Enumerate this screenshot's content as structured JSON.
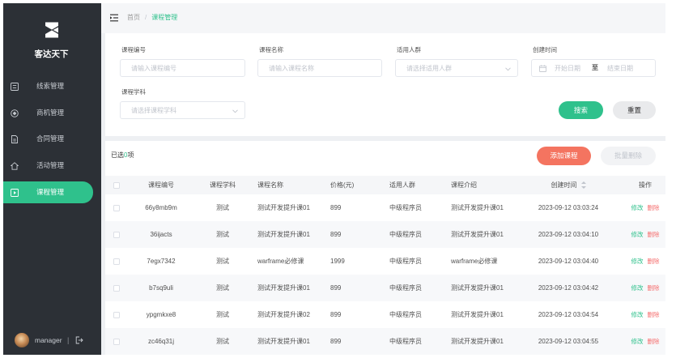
{
  "app": {
    "brand": "客达天下",
    "logo_icon": "brand-logo-icon"
  },
  "sidebar": {
    "items": [
      {
        "label": "线索管理",
        "icon": "clue-list-icon",
        "active": false
      },
      {
        "label": "商机管理",
        "icon": "opportunity-icon",
        "active": false
      },
      {
        "label": "合同管理",
        "icon": "contract-icon",
        "active": false
      },
      {
        "label": "活动管理",
        "icon": "activity-icon",
        "active": false
      },
      {
        "label": "课程管理",
        "icon": "course-icon",
        "active": true
      }
    ],
    "user": {
      "name": "manager",
      "separator": "|",
      "avatar_icon": "avatar",
      "logout_icon": "logout-icon"
    }
  },
  "topbar": {
    "menu_icon": "menu-fold-icon"
  },
  "breadcrumb": {
    "home": "首页",
    "separator": "/",
    "current": "课程管理"
  },
  "filters": {
    "course_code": {
      "label": "课程编号",
      "placeholder": "请输入课程编号"
    },
    "course_name": {
      "label": "课程名称",
      "placeholder": "请输入课程名称"
    },
    "audience": {
      "label": "适用人群",
      "placeholder": "请选择适用人群"
    },
    "created_time": {
      "label": "创建时间",
      "start_placeholder": "开始日期",
      "range_separator": "至",
      "end_placeholder": "结束日期"
    },
    "subject": {
      "label": "课程学科",
      "placeholder": "请选择课程学科"
    },
    "search_label": "搜索",
    "reset_label": "重置"
  },
  "toolbar": {
    "selected_prefix": "已选",
    "selected_count": "0",
    "selected_suffix": "项",
    "add_label": "添加课程",
    "batch_delete_label": "批量删除"
  },
  "table": {
    "columns": [
      "课程编号",
      "课程学科",
      "课程名称",
      "价格(元)",
      "适用人群",
      "课程介绍",
      "创建时间",
      "操作"
    ],
    "sort_icon": "sort-icon",
    "actions": {
      "edit": "修改",
      "delete": "删除"
    },
    "rows": [
      {
        "code": "66y8mb9m",
        "subject": "测试",
        "name": "测试开发提升课01",
        "price": "899",
        "audience": "中级程序员",
        "intro": "测试开发提升课01",
        "created": "2023-09-12 03:03:24"
      },
      {
        "code": "36ijacts",
        "subject": "测试",
        "name": "测试开发提升课01",
        "price": "899",
        "audience": "中级程序员",
        "intro": "测试开发提升课01",
        "created": "2023-09-12 03:04:10"
      },
      {
        "code": "7egx7342",
        "subject": "测试",
        "name": "warframe必修课",
        "price": "1999",
        "audience": "中级程序员",
        "intro": "warframe必修课",
        "created": "2023-09-12 03:04:40"
      },
      {
        "code": "b7sq9uli",
        "subject": "测试",
        "name": "测试开发提升课01",
        "price": "899",
        "audience": "中级程序员",
        "intro": "测试开发提升课01",
        "created": "2023-09-12 03:04:42"
      },
      {
        "code": "ypgmkxe8",
        "subject": "测试",
        "name": "测试开发提升课02",
        "price": "899",
        "audience": "中级程序员",
        "intro": "测试开发提升课01",
        "created": "2023-09-12 03:04:54"
      },
      {
        "code": "zc46q31j",
        "subject": "测试",
        "name": "测试开发提升课01",
        "price": "899",
        "audience": "中级程序员",
        "intro": "测试开发提升课01",
        "created": "2023-09-12 03:04:55"
      }
    ]
  },
  "colors": {
    "accent": "#2fc18c",
    "sidebar_bg": "#2c3036",
    "add_button": "#f47460",
    "danger": "#f56c6c"
  }
}
